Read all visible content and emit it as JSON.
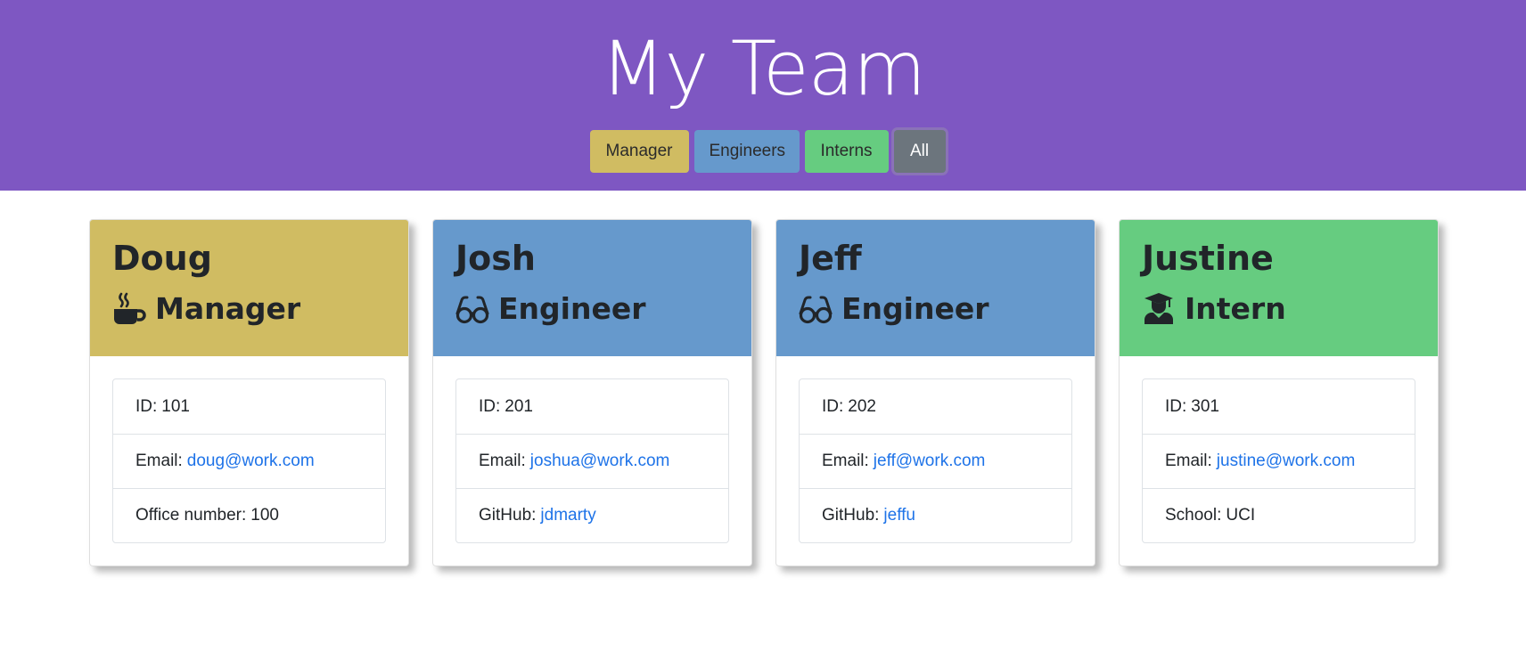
{
  "header": {
    "title": "My Team",
    "filters": [
      {
        "label": "Manager",
        "color": "#d0bc62"
      },
      {
        "label": "Engineers",
        "color": "#6699cc"
      },
      {
        "label": "Interns",
        "color": "#66cc80"
      },
      {
        "label": "All",
        "color": "#6c757d"
      }
    ],
    "background": "#7e57c2"
  },
  "cards": [
    {
      "name": "Doug",
      "role": "Manager",
      "icon": "mug-icon",
      "color": "#d0bc62",
      "id_label": "ID:",
      "id_value": "101",
      "email_label": "Email:",
      "email": "doug@work.com",
      "extra_label": "Office number:",
      "extra_value": "100"
    },
    {
      "name": "Josh",
      "role": "Engineer",
      "icon": "glasses-icon",
      "color": "#6699cc",
      "id_label": "ID:",
      "id_value": "201",
      "email_label": "Email:",
      "email": "joshua@work.com",
      "extra_label": "GitHub:",
      "extra_value": "jdmarty"
    },
    {
      "name": "Jeff",
      "role": "Engineer",
      "icon": "glasses-icon",
      "color": "#6699cc",
      "id_label": "ID:",
      "id_value": "202",
      "email_label": "Email:",
      "email": "jeff@work.com",
      "extra_label": "GitHub:",
      "extra_value": "jeffu"
    },
    {
      "name": "Justine",
      "role": "Intern",
      "icon": "graduate-icon",
      "color": "#66cc80",
      "id_label": "ID:",
      "id_value": "301",
      "email_label": "Email:",
      "email": "justine@work.com",
      "extra_label": "School:",
      "extra_value": "UCI"
    }
  ]
}
